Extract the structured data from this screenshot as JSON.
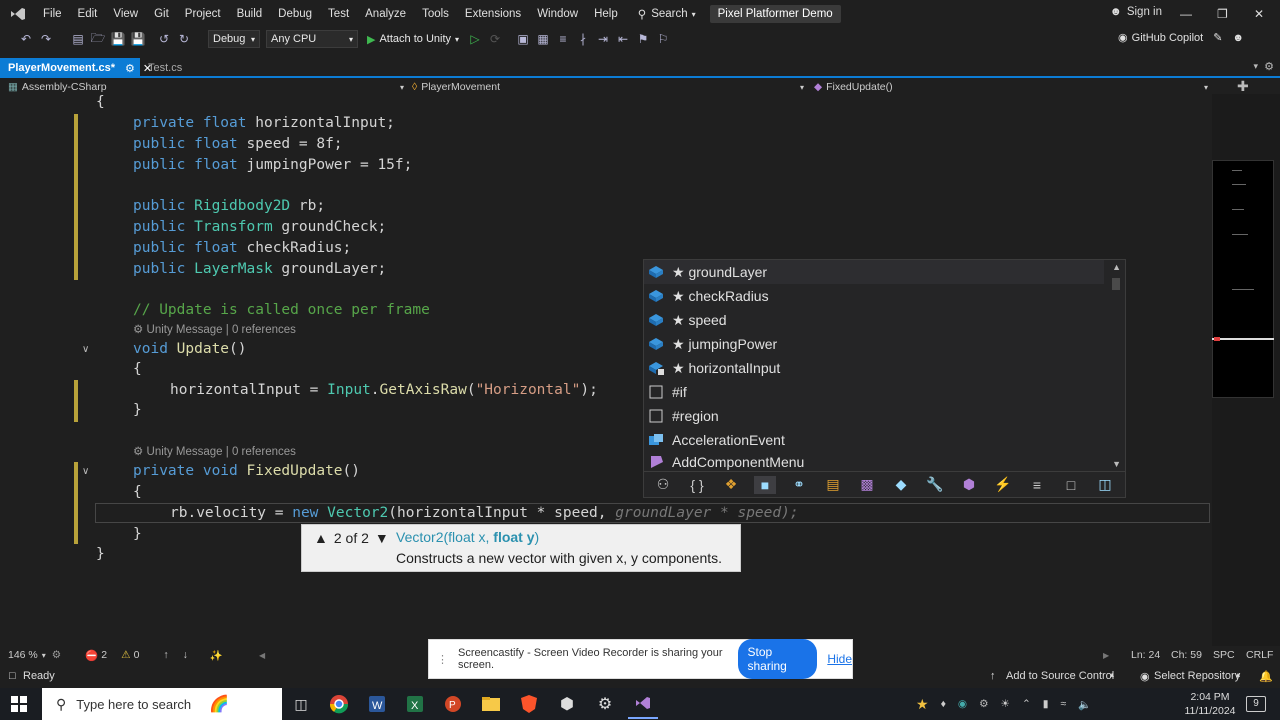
{
  "menu": {
    "items": [
      "File",
      "Edit",
      "View",
      "Git",
      "Project",
      "Build",
      "Debug",
      "Test",
      "Analyze",
      "Tools",
      "Extensions",
      "Window",
      "Help"
    ],
    "search_label": "Search",
    "project_title": "Pixel Platformer Demo",
    "sign_in": "Sign in"
  },
  "toolbar": {
    "config": "Debug",
    "platform": "Any CPU",
    "attach_label": "Attach to Unity",
    "copilot_label": "GitHub Copilot"
  },
  "tabs": [
    {
      "label": "PlayerMovement.cs*",
      "active": true
    },
    {
      "label": "Test.cs",
      "active": false
    }
  ],
  "navbar": {
    "project": "Assembly-CSharp",
    "class": "PlayerMovement",
    "member": "FixedUpdate()"
  },
  "code": {
    "lens_unity": "Unity Message",
    "lens_refs": "0 references",
    "update_comment": "// Update is called once per frame"
  },
  "completion": {
    "items": [
      {
        "label": "★ groundLayer",
        "icon": "field-icon"
      },
      {
        "label": "★ checkRadius",
        "icon": "field-icon"
      },
      {
        "label": "★ speed",
        "icon": "field-icon"
      },
      {
        "label": "★ jumpingPower",
        "icon": "field-icon"
      },
      {
        "label": "★ horizontalInput",
        "icon": "private-field-icon"
      },
      {
        "label": "#if",
        "icon": "snippet-icon"
      },
      {
        "label": "#region",
        "icon": "snippet-icon"
      },
      {
        "label": "AccelerationEvent",
        "icon": "class-icon"
      },
      {
        "label": "AddComponentMenu",
        "icon": "class-icon"
      }
    ]
  },
  "signature": {
    "counter": "2 of 2",
    "method": "Vector2",
    "open": "(",
    "param1": "float x",
    "sep": ", ",
    "param2": "float y",
    "close": ")",
    "description": "Constructs a new vector with given x, y components."
  },
  "status": {
    "zoom": "146 %",
    "errors": "2",
    "warnings": "0",
    "ln": "Ln: 24",
    "ch": "Ch: 59",
    "spc": "SPC",
    "crlf": "CRLF",
    "ready": "Ready",
    "source_control": "Add to Source Control",
    "repo": "Select Repository"
  },
  "cast": {
    "message": "Screencastify - Screen Video Recorder is sharing your screen.",
    "stop": "Stop sharing",
    "hide": "Hide"
  },
  "taskbar": {
    "search_placeholder": "Type here to search",
    "time": "2:04 PM",
    "date": "11/11/2024",
    "notifications": "9"
  },
  "colors": {
    "accent": "#0c7cd5",
    "keyword": "#569cd6",
    "type": "#4ec9b0",
    "comment": "#57a64a",
    "string": "#d69d85"
  }
}
